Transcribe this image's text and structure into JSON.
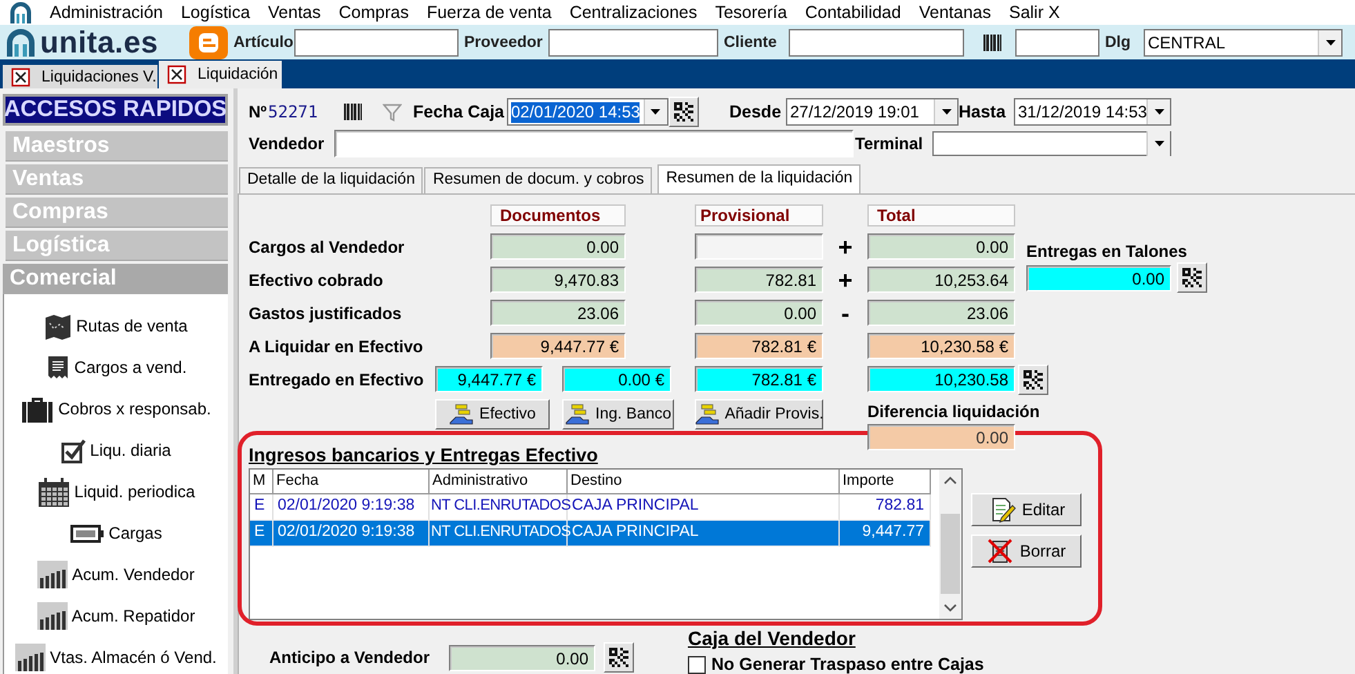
{
  "menu": [
    "Administración",
    "Logística",
    "Ventas",
    "Compras",
    "Fuerza de venta",
    "Centralizaciones",
    "Tesorería",
    "Contabilidad",
    "Ventanas",
    "Salir X"
  ],
  "logo": {
    "text": "unita.es"
  },
  "toolbar": {
    "fields": [
      {
        "label": "Artículo"
      },
      {
        "label": "Proveedor"
      },
      {
        "label": "Cliente"
      }
    ],
    "dlg": {
      "label": "Dlg",
      "value": "CENTRAL"
    }
  },
  "document_tabs": [
    {
      "label": "Liquidaciones V.",
      "selected": false
    },
    {
      "label": "Liquidación",
      "selected": true
    }
  ],
  "sidebar": {
    "title": "ACCESOS RAPIDOS",
    "groups": [
      {
        "label": "Maestros",
        "expanded": false
      },
      {
        "label": "Ventas",
        "expanded": false
      },
      {
        "label": "Compras",
        "expanded": false
      },
      {
        "label": "Logística",
        "expanded": false
      },
      {
        "label": "Comercial",
        "expanded": true,
        "items": [
          {
            "label": "Rutas de venta",
            "kind": "map"
          },
          {
            "label": "Cargos a vend.",
            "kind": "receipt"
          },
          {
            "label": "Cobros x responsab.",
            "kind": "briefcase"
          },
          {
            "label": "Liqu. diaria",
            "kind": "check"
          },
          {
            "label": "Liquid. periodica",
            "kind": "calendar"
          },
          {
            "label": "Cargas",
            "kind": "battery"
          },
          {
            "label": "Acum. Vendedor",
            "kind": "chart"
          },
          {
            "label": "Acum. Repatidor",
            "kind": "chart"
          },
          {
            "label": "Vtas. Almacén ó Vend.",
            "kind": "chart"
          }
        ]
      }
    ]
  },
  "header": {
    "number_label": "Nº",
    "number": "52271",
    "fecha_caja": {
      "label": "Fecha Caja",
      "value": "02/01/2020 14:53",
      "highlighted": true
    },
    "desde": {
      "label": "Desde",
      "value": "27/12/2019 19:01"
    },
    "hasta": {
      "label": "Hasta",
      "value": "31/12/2019 14:53"
    },
    "vendedor": {
      "label": "Vendedor"
    },
    "terminal": {
      "label": "Terminal"
    }
  },
  "tabs": [
    {
      "label": "Detalle de la liquidación",
      "selected": false
    },
    {
      "label": "Resumen de docum. y cobros",
      "selected": false
    },
    {
      "label": "Resumen de la liquidación",
      "selected": true
    }
  ],
  "summary": {
    "columns": [
      "Documentos",
      "Provisional",
      "Total"
    ],
    "rows": [
      {
        "kind": "charge",
        "label": "Cargos al Vendedor",
        "documentos": "0.00",
        "sign": "+",
        "total": "0.00"
      },
      {
        "kind": "charge",
        "label": "Efectivo cobrado",
        "documentos": "9,470.83",
        "provisional": "782.81",
        "sign": "+",
        "total": "10,253.64"
      },
      {
        "kind": "charge",
        "label": "Gastos justificados",
        "documentos": "23.06",
        "provisional": "0.00",
        "sign": "-",
        "total": "23.06"
      },
      {
        "kind": "result",
        "label": "A Liquidar en Efectivo",
        "documentos": "9,447.77 €",
        "provisional": "782.81 €",
        "total": "10,230.58 €"
      },
      {
        "kind": "delivered",
        "label": "Entregado en Efectivo",
        "efectivo": "9,447.77 €",
        "banco": "0.00 €",
        "provisional": "782.81 €",
        "total": "10,230.58"
      }
    ]
  },
  "actions": [
    {
      "label": "Efectivo"
    },
    {
      "label": "Ing. Banco"
    },
    {
      "label": "Añadir Provis."
    }
  ],
  "talones": {
    "label": "Entregas en Talones",
    "value": "0.00"
  },
  "diferencia": {
    "label": "Diferencia liquidación",
    "value": "0.00"
  },
  "ingresos": {
    "title": "Ingresos bancarios y Entregas Efectivo",
    "columns": [
      "M",
      "Fecha",
      "Administrativo",
      "Destino",
      "Importe"
    ],
    "rows": [
      {
        "selected": false,
        "cells": [
          "E",
          "02/01/2020 9:19:38",
          "NT CLI.ENRUTADOS",
          "CAJA PRINCIPAL",
          "782.81"
        ]
      },
      {
        "selected": true,
        "cells": [
          "E",
          "02/01/2020 9:19:38",
          "NT CLI.ENRUTADOS",
          "CAJA PRINCIPAL",
          "9,447.77"
        ]
      }
    ],
    "buttons": [
      {
        "label": "Editar",
        "kind": "edit"
      },
      {
        "label": "Borrar",
        "kind": "delete"
      }
    ]
  },
  "anticipo": {
    "label": "Anticipo a Vendedor",
    "value": "0.00"
  },
  "caja_vendedor": {
    "title": "Caja del Vendedor",
    "option": {
      "label": "No Generar Traspaso entre Cajas",
      "checked": false
    }
  }
}
